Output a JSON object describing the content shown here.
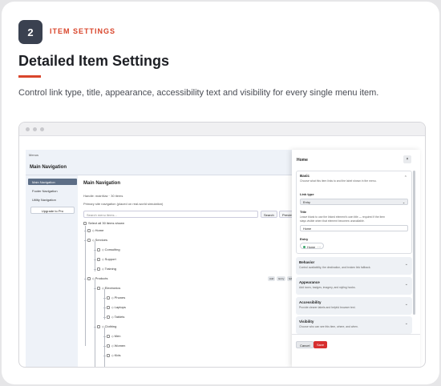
{
  "step_number": "2",
  "eyebrow": "ITEM SETTINGS",
  "headline": "Detailed Item Settings",
  "description": "Control link type, title, appearance, accessibility text and visibility for every single menu item.",
  "app": {
    "topbar": "Menus",
    "title": "Main Navigation",
    "sidebar": [
      {
        "label": "Main Navigation",
        "active": true
      },
      {
        "label": "Footer Navigation",
        "active": false
      },
      {
        "label": "Utility Navigation",
        "active": false
      }
    ],
    "upgrade": "Upgrade to Pro",
    "main_title": "Main Navigation",
    "handle_line": "Handle: mainNav · 30 items",
    "desc_line": "Primary site navigation (placed on real-world simulation)",
    "search_placeholder": "Search menu items...",
    "search_btn": "Search",
    "preview_btn": "Preview",
    "select_all": "Select all 30 items shown",
    "tree": [
      {
        "label": "Home",
        "depth": 0
      },
      {
        "label": "Services",
        "depth": 0
      },
      {
        "label": "Consulting",
        "depth": 1
      },
      {
        "label": "Support",
        "depth": 1
      },
      {
        "label": "Training",
        "depth": 1
      },
      {
        "label": "Products",
        "depth": 0,
        "badges": [
          "Add",
          "Entry",
          "Edit"
        ]
      },
      {
        "label": "Electronics",
        "depth": 1
      },
      {
        "label": "Phones",
        "depth": 2
      },
      {
        "label": "Laptops",
        "depth": 2
      },
      {
        "label": "Tablets",
        "depth": 2
      },
      {
        "label": "Clothing",
        "depth": 1
      },
      {
        "label": "Men",
        "depth": 2
      },
      {
        "label": "Women",
        "depth": 2
      },
      {
        "label": "Kids",
        "depth": 2
      }
    ]
  },
  "panel": {
    "title": "Home",
    "close": "×",
    "basic_title": "Basic",
    "basic_sub": "Choose what this item links to and the label shown in the menu.",
    "link_type_label": "Link type",
    "link_type_value": "Entry",
    "title_label": "Title",
    "title_help_1": "Leave blank to use the linked element's own title — required if the item",
    "title_help_2": "stays visible when that element becomes unavailable.",
    "title_value": "Home",
    "entry_label": "Entry",
    "entry_value": "Home",
    "sections": [
      {
        "title": "Behavior",
        "sub": "Control availability, the destination, and broken link fallback."
      },
      {
        "title": "Appearance",
        "sub": "Add icons, badges, imagery, and styling hooks."
      },
      {
        "title": "Accessibility",
        "sub": "Provide clearer labels and helpful browser text."
      },
      {
        "title": "Visibility",
        "sub": "Choose who can see this item, where, and when."
      }
    ],
    "cancel": "Cancel",
    "save": "Save"
  },
  "colors": {
    "accent": "#d9452b",
    "save": "#d72f2f",
    "badge_bg": "#3a4150"
  }
}
